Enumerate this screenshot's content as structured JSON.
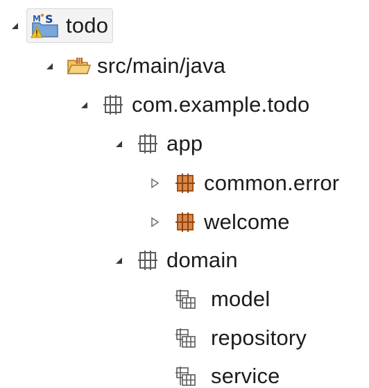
{
  "tree": {
    "root": {
      "label": "todo",
      "icon": "maven-spring-project-icon",
      "expanded": true
    },
    "src": {
      "label": "src/main/java",
      "icon": "source-folder-icon",
      "expanded": true
    },
    "pkg_root": {
      "label": "com.example.todo",
      "icon": "package-icon",
      "expanded": true
    },
    "app": {
      "label": "app",
      "icon": "package-icon",
      "expanded": true
    },
    "common_error": {
      "label": "common.error",
      "icon": "package-orange-icon",
      "expanded": false
    },
    "welcome": {
      "label": "welcome",
      "icon": "package-orange-icon",
      "expanded": false
    },
    "domain": {
      "label": "domain",
      "icon": "package-icon",
      "expanded": true
    },
    "model": {
      "label": "model",
      "icon": "empty-package-icon"
    },
    "repository": {
      "label": "repository",
      "icon": "empty-package-icon"
    },
    "service": {
      "label": "service",
      "icon": "empty-package-icon"
    }
  },
  "colors": {
    "twisty": "#3a3a3a",
    "package_outline": "#5a5a5a",
    "package_orange": "#c0651e",
    "folder": "#e6a53a",
    "spring_green": "#6db33f",
    "maven_blue": "#2b5fa8"
  }
}
